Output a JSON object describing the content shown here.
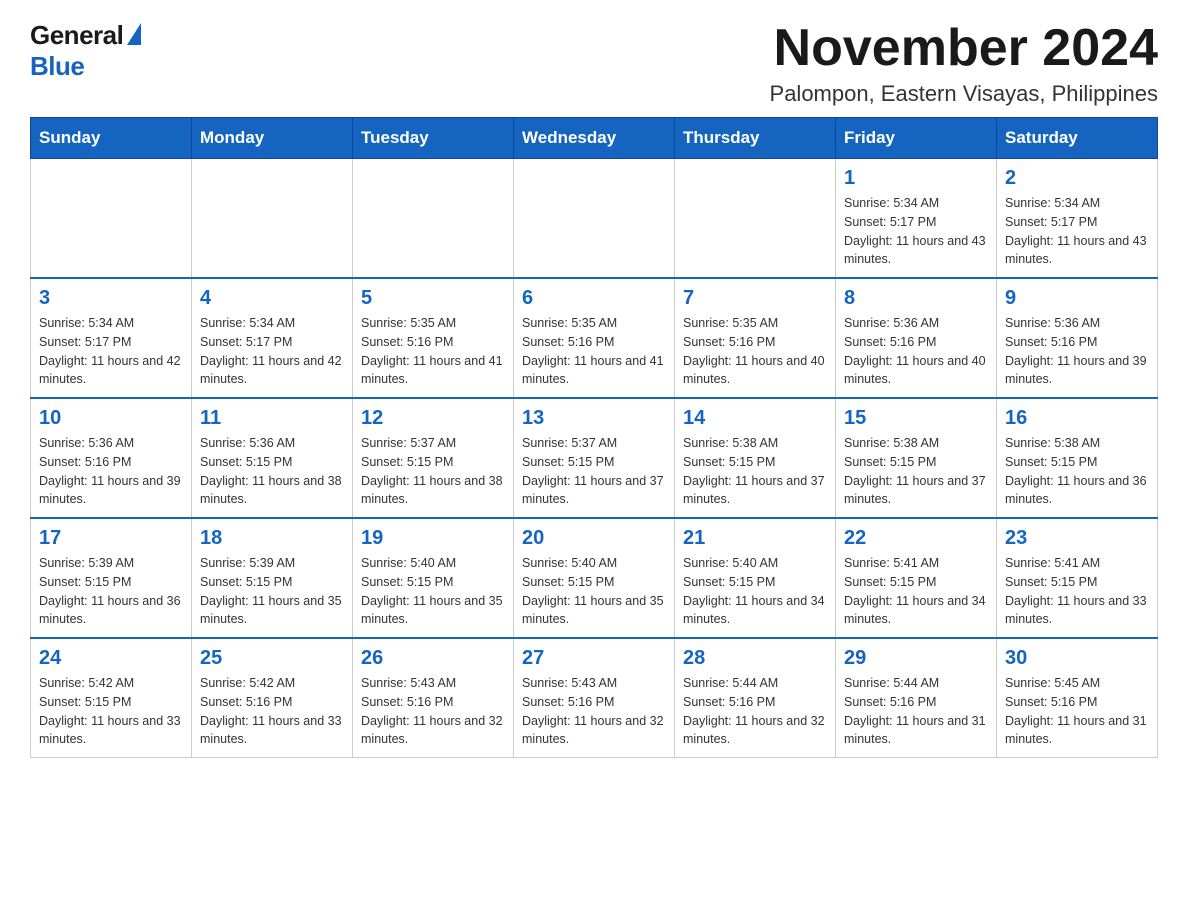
{
  "logo": {
    "general": "General",
    "blue": "Blue"
  },
  "title": {
    "month_year": "November 2024",
    "location": "Palompon, Eastern Visayas, Philippines"
  },
  "weekdays": [
    "Sunday",
    "Monday",
    "Tuesday",
    "Wednesday",
    "Thursday",
    "Friday",
    "Saturday"
  ],
  "weeks": [
    [
      {
        "day": "",
        "sunrise": "",
        "sunset": "",
        "daylight": "",
        "empty": true
      },
      {
        "day": "",
        "sunrise": "",
        "sunset": "",
        "daylight": "",
        "empty": true
      },
      {
        "day": "",
        "sunrise": "",
        "sunset": "",
        "daylight": "",
        "empty": true
      },
      {
        "day": "",
        "sunrise": "",
        "sunset": "",
        "daylight": "",
        "empty": true
      },
      {
        "day": "",
        "sunrise": "",
        "sunset": "",
        "daylight": "",
        "empty": true
      },
      {
        "day": "1",
        "sunrise": "Sunrise: 5:34 AM",
        "sunset": "Sunset: 5:17 PM",
        "daylight": "Daylight: 11 hours and 43 minutes."
      },
      {
        "day": "2",
        "sunrise": "Sunrise: 5:34 AM",
        "sunset": "Sunset: 5:17 PM",
        "daylight": "Daylight: 11 hours and 43 minutes."
      }
    ],
    [
      {
        "day": "3",
        "sunrise": "Sunrise: 5:34 AM",
        "sunset": "Sunset: 5:17 PM",
        "daylight": "Daylight: 11 hours and 42 minutes."
      },
      {
        "day": "4",
        "sunrise": "Sunrise: 5:34 AM",
        "sunset": "Sunset: 5:17 PM",
        "daylight": "Daylight: 11 hours and 42 minutes."
      },
      {
        "day": "5",
        "sunrise": "Sunrise: 5:35 AM",
        "sunset": "Sunset: 5:16 PM",
        "daylight": "Daylight: 11 hours and 41 minutes."
      },
      {
        "day": "6",
        "sunrise": "Sunrise: 5:35 AM",
        "sunset": "Sunset: 5:16 PM",
        "daylight": "Daylight: 11 hours and 41 minutes."
      },
      {
        "day": "7",
        "sunrise": "Sunrise: 5:35 AM",
        "sunset": "Sunset: 5:16 PM",
        "daylight": "Daylight: 11 hours and 40 minutes."
      },
      {
        "day": "8",
        "sunrise": "Sunrise: 5:36 AM",
        "sunset": "Sunset: 5:16 PM",
        "daylight": "Daylight: 11 hours and 40 minutes."
      },
      {
        "day": "9",
        "sunrise": "Sunrise: 5:36 AM",
        "sunset": "Sunset: 5:16 PM",
        "daylight": "Daylight: 11 hours and 39 minutes."
      }
    ],
    [
      {
        "day": "10",
        "sunrise": "Sunrise: 5:36 AM",
        "sunset": "Sunset: 5:16 PM",
        "daylight": "Daylight: 11 hours and 39 minutes."
      },
      {
        "day": "11",
        "sunrise": "Sunrise: 5:36 AM",
        "sunset": "Sunset: 5:15 PM",
        "daylight": "Daylight: 11 hours and 38 minutes."
      },
      {
        "day": "12",
        "sunrise": "Sunrise: 5:37 AM",
        "sunset": "Sunset: 5:15 PM",
        "daylight": "Daylight: 11 hours and 38 minutes."
      },
      {
        "day": "13",
        "sunrise": "Sunrise: 5:37 AM",
        "sunset": "Sunset: 5:15 PM",
        "daylight": "Daylight: 11 hours and 37 minutes."
      },
      {
        "day": "14",
        "sunrise": "Sunrise: 5:38 AM",
        "sunset": "Sunset: 5:15 PM",
        "daylight": "Daylight: 11 hours and 37 minutes."
      },
      {
        "day": "15",
        "sunrise": "Sunrise: 5:38 AM",
        "sunset": "Sunset: 5:15 PM",
        "daylight": "Daylight: 11 hours and 37 minutes."
      },
      {
        "day": "16",
        "sunrise": "Sunrise: 5:38 AM",
        "sunset": "Sunset: 5:15 PM",
        "daylight": "Daylight: 11 hours and 36 minutes."
      }
    ],
    [
      {
        "day": "17",
        "sunrise": "Sunrise: 5:39 AM",
        "sunset": "Sunset: 5:15 PM",
        "daylight": "Daylight: 11 hours and 36 minutes."
      },
      {
        "day": "18",
        "sunrise": "Sunrise: 5:39 AM",
        "sunset": "Sunset: 5:15 PM",
        "daylight": "Daylight: 11 hours and 35 minutes."
      },
      {
        "day": "19",
        "sunrise": "Sunrise: 5:40 AM",
        "sunset": "Sunset: 5:15 PM",
        "daylight": "Daylight: 11 hours and 35 minutes."
      },
      {
        "day": "20",
        "sunrise": "Sunrise: 5:40 AM",
        "sunset": "Sunset: 5:15 PM",
        "daylight": "Daylight: 11 hours and 35 minutes."
      },
      {
        "day": "21",
        "sunrise": "Sunrise: 5:40 AM",
        "sunset": "Sunset: 5:15 PM",
        "daylight": "Daylight: 11 hours and 34 minutes."
      },
      {
        "day": "22",
        "sunrise": "Sunrise: 5:41 AM",
        "sunset": "Sunset: 5:15 PM",
        "daylight": "Daylight: 11 hours and 34 minutes."
      },
      {
        "day": "23",
        "sunrise": "Sunrise: 5:41 AM",
        "sunset": "Sunset: 5:15 PM",
        "daylight": "Daylight: 11 hours and 33 minutes."
      }
    ],
    [
      {
        "day": "24",
        "sunrise": "Sunrise: 5:42 AM",
        "sunset": "Sunset: 5:15 PM",
        "daylight": "Daylight: 11 hours and 33 minutes."
      },
      {
        "day": "25",
        "sunrise": "Sunrise: 5:42 AM",
        "sunset": "Sunset: 5:16 PM",
        "daylight": "Daylight: 11 hours and 33 minutes."
      },
      {
        "day": "26",
        "sunrise": "Sunrise: 5:43 AM",
        "sunset": "Sunset: 5:16 PM",
        "daylight": "Daylight: 11 hours and 32 minutes."
      },
      {
        "day": "27",
        "sunrise": "Sunrise: 5:43 AM",
        "sunset": "Sunset: 5:16 PM",
        "daylight": "Daylight: 11 hours and 32 minutes."
      },
      {
        "day": "28",
        "sunrise": "Sunrise: 5:44 AM",
        "sunset": "Sunset: 5:16 PM",
        "daylight": "Daylight: 11 hours and 32 minutes."
      },
      {
        "day": "29",
        "sunrise": "Sunrise: 5:44 AM",
        "sunset": "Sunset: 5:16 PM",
        "daylight": "Daylight: 11 hours and 31 minutes."
      },
      {
        "day": "30",
        "sunrise": "Sunrise: 5:45 AM",
        "sunset": "Sunset: 5:16 PM",
        "daylight": "Daylight: 11 hours and 31 minutes."
      }
    ]
  ]
}
